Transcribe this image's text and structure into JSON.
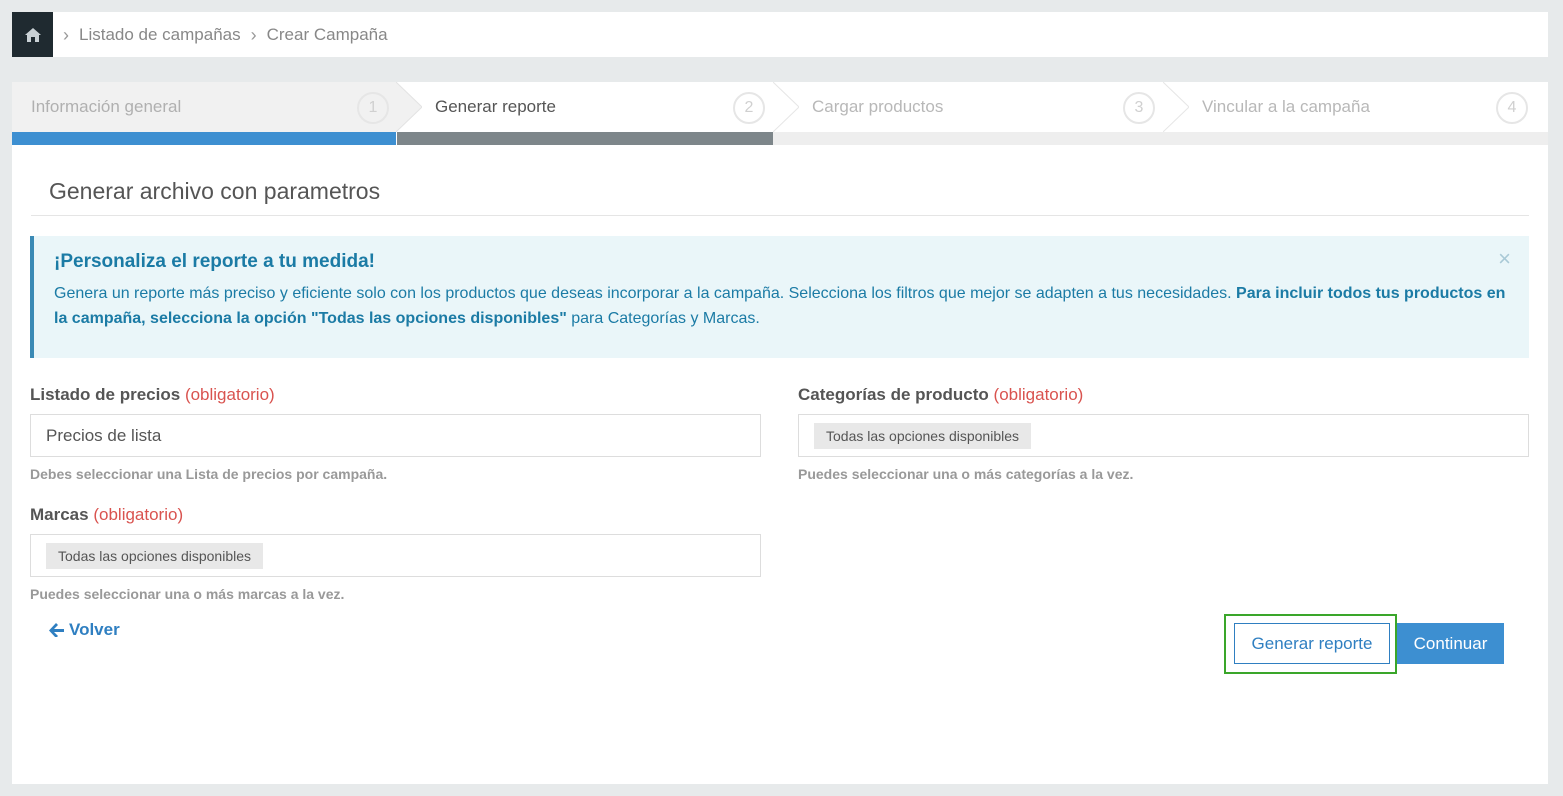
{
  "breadcrumb": {
    "home_icon": "home-icon",
    "items": [
      "Listado de campañas",
      "Crear Campaña"
    ]
  },
  "wizard": {
    "steps": [
      {
        "label": "Información general",
        "number": "1",
        "state": "completed"
      },
      {
        "label": "Generar reporte",
        "number": "2",
        "state": "active"
      },
      {
        "label": "Cargar productos",
        "number": "3",
        "state": "pending"
      },
      {
        "label": "Vincular a la campaña",
        "number": "4",
        "state": "pending"
      }
    ]
  },
  "panel": {
    "title": "Generar archivo con parametros"
  },
  "alert": {
    "heading": "¡Personaliza el reporte a tu medida!",
    "text_1": "Genera un reporte más preciso y eficiente solo con los productos que deseas incorporar a la campaña. Selecciona los filtros que mejor se adapten a tus necesidades. ",
    "text_bold": "Para incluir todos tus productos en la campaña, selecciona la opción \"Todas las opciones disponibles\"",
    "text_2": " para Categorías y Marcas.",
    "close": "×"
  },
  "form": {
    "price_list": {
      "label": "Listado de precios",
      "required": "(obligatorio)",
      "value": "Precios de lista",
      "help": "Debes seleccionar una Lista de precios por campaña."
    },
    "categories": {
      "label": "Categorías de producto",
      "required": "(obligatorio)",
      "tag": "Todas las opciones disponibles",
      "help": "Puedes seleccionar una o más categorías a la vez."
    },
    "brands": {
      "label": "Marcas",
      "required": "(obligatorio)",
      "tag": "Todas las opciones disponibles",
      "help": "Puedes seleccionar una o más marcas a la vez."
    }
  },
  "actions": {
    "back": "Volver",
    "generate": "Generar reporte",
    "continue": "Continuar"
  },
  "colors": {
    "completed_bar": "#3d8fd1",
    "active_bar": "#7d868a",
    "accent": "#2f7fc1",
    "highlight": "#3aa62a"
  }
}
